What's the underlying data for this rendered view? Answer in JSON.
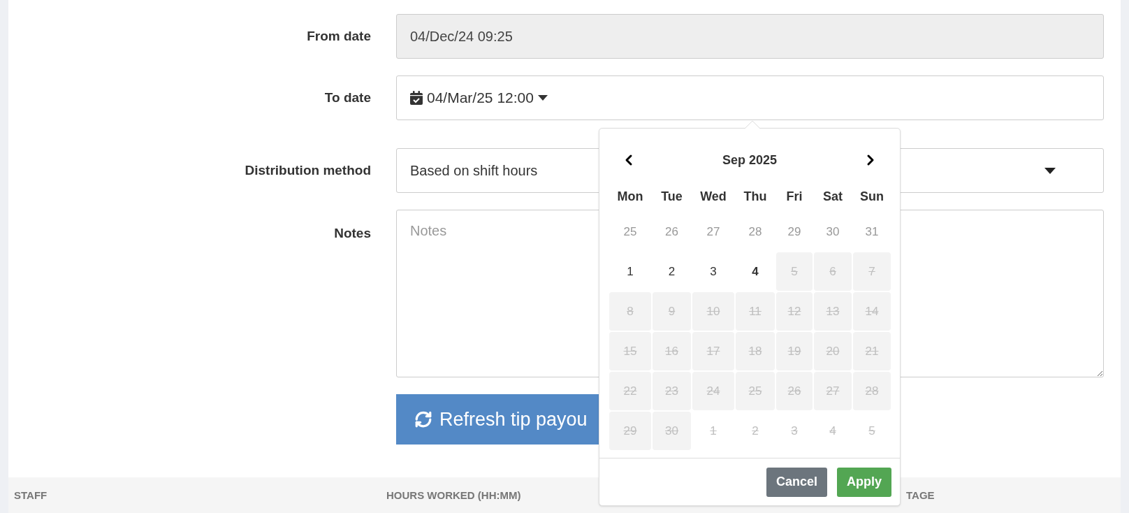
{
  "form": {
    "from_date": {
      "label": "From date",
      "value": "04/Dec/24 09:25",
      "disabled": true
    },
    "to_date": {
      "label": "To date",
      "value": "04/Mar/25 12:00"
    },
    "distribution": {
      "label": "Distribution method",
      "value": "Based on shift hours"
    },
    "notes": {
      "label": "Notes",
      "placeholder": "Notes"
    },
    "refresh_button": "Refresh tip payou"
  },
  "table": {
    "columns": [
      "STAFF",
      "HOURS WORKED (HH:MM)",
      "TAGE"
    ]
  },
  "datepicker": {
    "month": "Sep 2025",
    "weekdays": [
      "Mon",
      "Tue",
      "Wed",
      "Thu",
      "Fri",
      "Sat",
      "Sun"
    ],
    "days": [
      {
        "label": "25",
        "kind": "outside",
        "disabled": false
      },
      {
        "label": "26",
        "kind": "outside",
        "disabled": false
      },
      {
        "label": "27",
        "kind": "outside",
        "disabled": false
      },
      {
        "label": "28",
        "kind": "outside",
        "disabled": false
      },
      {
        "label": "29",
        "kind": "outside",
        "disabled": false
      },
      {
        "label": "30",
        "kind": "outside",
        "disabled": false
      },
      {
        "label": "31",
        "kind": "outside",
        "disabled": false
      },
      {
        "label": "1",
        "kind": "day",
        "disabled": false
      },
      {
        "label": "2",
        "kind": "day",
        "disabled": false
      },
      {
        "label": "3",
        "kind": "day",
        "disabled": false
      },
      {
        "label": "4",
        "kind": "today",
        "disabled": false
      },
      {
        "label": "5",
        "kind": "day",
        "disabled": true
      },
      {
        "label": "6",
        "kind": "day",
        "disabled": true
      },
      {
        "label": "7",
        "kind": "day",
        "disabled": true
      },
      {
        "label": "8",
        "kind": "day",
        "disabled": true
      },
      {
        "label": "9",
        "kind": "day",
        "disabled": true
      },
      {
        "label": "10",
        "kind": "day",
        "disabled": true
      },
      {
        "label": "11",
        "kind": "day",
        "disabled": true
      },
      {
        "label": "12",
        "kind": "day",
        "disabled": true
      },
      {
        "label": "13",
        "kind": "day",
        "disabled": true
      },
      {
        "label": "14",
        "kind": "day",
        "disabled": true
      },
      {
        "label": "15",
        "kind": "day",
        "disabled": true
      },
      {
        "label": "16",
        "kind": "day",
        "disabled": true
      },
      {
        "label": "17",
        "kind": "day",
        "disabled": true
      },
      {
        "label": "18",
        "kind": "day",
        "disabled": true
      },
      {
        "label": "19",
        "kind": "day",
        "disabled": true
      },
      {
        "label": "20",
        "kind": "day",
        "disabled": true
      },
      {
        "label": "21",
        "kind": "day",
        "disabled": true
      },
      {
        "label": "22",
        "kind": "day",
        "disabled": true
      },
      {
        "label": "23",
        "kind": "day",
        "disabled": true
      },
      {
        "label": "24",
        "kind": "day",
        "disabled": true
      },
      {
        "label": "25",
        "kind": "day",
        "disabled": true
      },
      {
        "label": "26",
        "kind": "day",
        "disabled": true
      },
      {
        "label": "27",
        "kind": "day",
        "disabled": true
      },
      {
        "label": "28",
        "kind": "day",
        "disabled": true
      },
      {
        "label": "29",
        "kind": "day",
        "disabled": true
      },
      {
        "label": "30",
        "kind": "day",
        "disabled": true
      },
      {
        "label": "1",
        "kind": "outside",
        "disabled": true
      },
      {
        "label": "2",
        "kind": "outside",
        "disabled": true
      },
      {
        "label": "3",
        "kind": "outside",
        "disabled": true
      },
      {
        "label": "4",
        "kind": "outside",
        "disabled": true
      },
      {
        "label": "5",
        "kind": "outside",
        "disabled": true
      }
    ],
    "buttons": {
      "cancel": "Cancel",
      "apply": "Apply"
    }
  }
}
